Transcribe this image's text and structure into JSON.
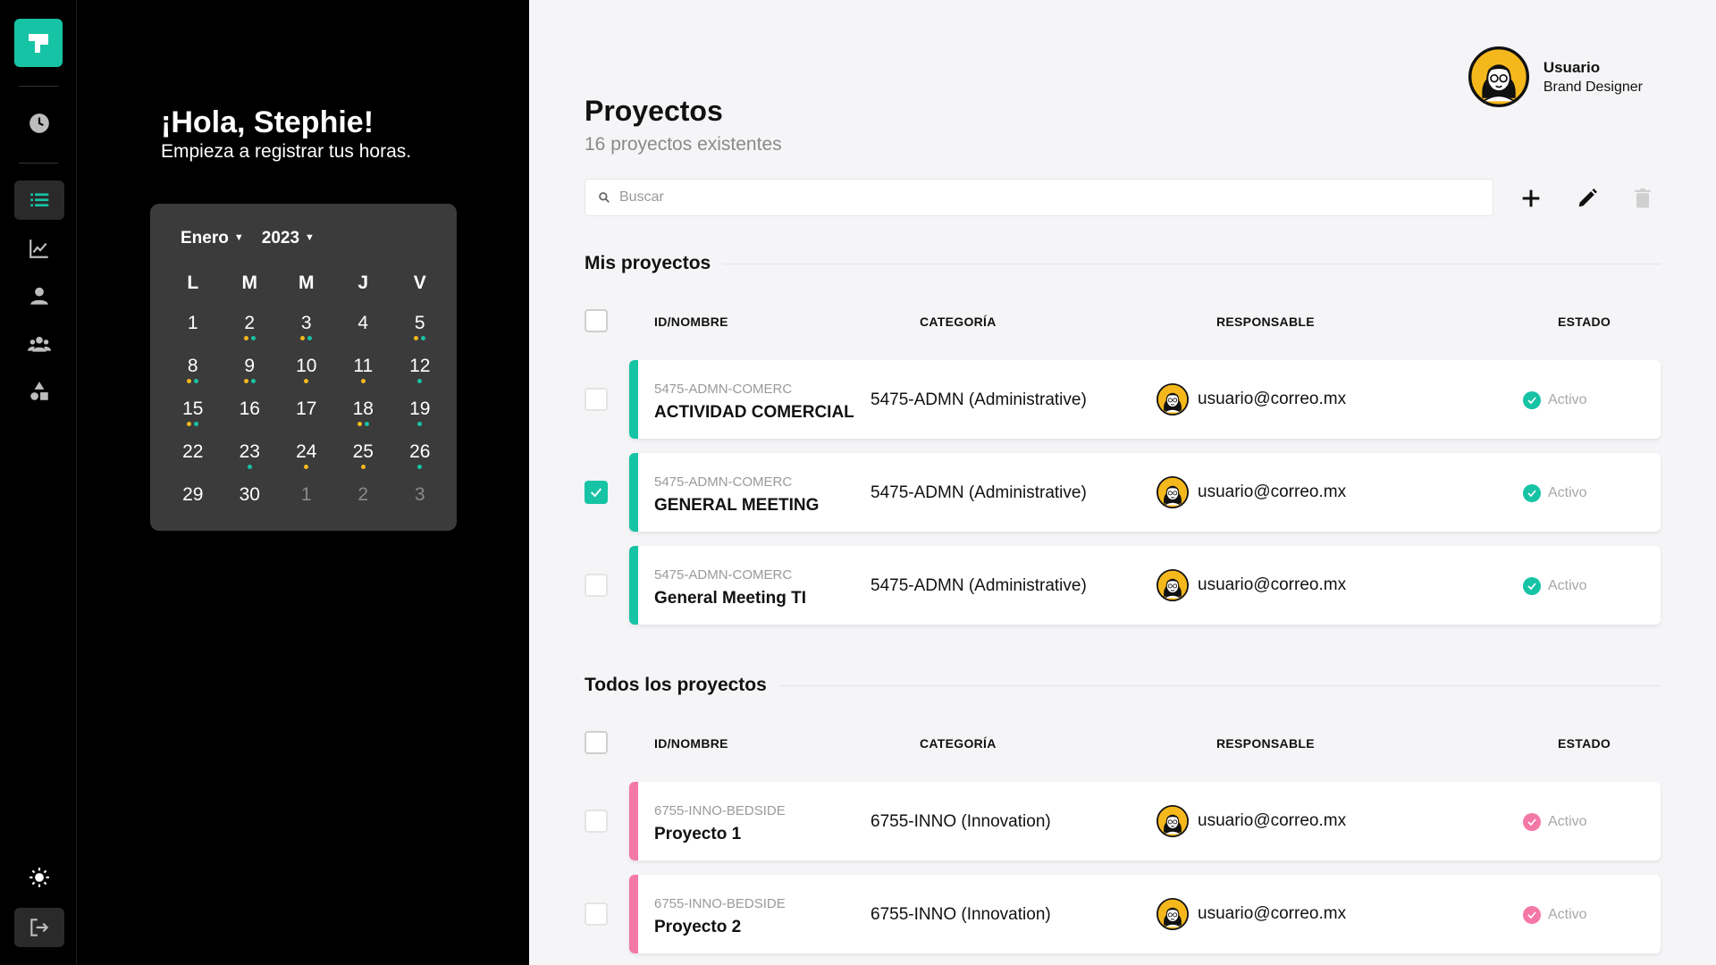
{
  "colors": {
    "teal": "#17c3a5",
    "pink": "#f478a6",
    "dot_yellow": "#f5b81c",
    "dot_teal": "#17c3a5"
  },
  "sidebar": {
    "logo_icon": "app-logo-icon",
    "items": [
      {
        "icon": "clock-icon",
        "name": "nav-clock"
      },
      {
        "icon": "list-icon",
        "name": "nav-projects",
        "active": true
      },
      {
        "icon": "chart-icon",
        "name": "nav-reports"
      },
      {
        "icon": "user-icon",
        "name": "nav-user"
      },
      {
        "icon": "team-icon",
        "name": "nav-team"
      },
      {
        "icon": "shapes-icon",
        "name": "nav-categories"
      }
    ],
    "bottom": [
      {
        "icon": "sun-icon"
      },
      {
        "icon": "logout-icon"
      }
    ]
  },
  "greeting": {
    "title": "¡Hola, Stephie!",
    "subtitle": "Empieza a registrar tus horas."
  },
  "calendar": {
    "month": "Enero",
    "year": "2023",
    "weekdays": [
      "L",
      "M",
      "M",
      "J",
      "V"
    ],
    "days": [
      {
        "d": "1",
        "dots": []
      },
      {
        "d": "2",
        "dots": [
          "y",
          "t"
        ]
      },
      {
        "d": "3",
        "dots": [
          "y",
          "t"
        ]
      },
      {
        "d": "4",
        "dots": []
      },
      {
        "d": "5",
        "dots": [
          "y",
          "t"
        ]
      },
      {
        "d": "8",
        "dots": [
          "y",
          "t"
        ]
      },
      {
        "d": "9",
        "dots": [
          "y",
          "t"
        ]
      },
      {
        "d": "10",
        "dots": [
          "y"
        ]
      },
      {
        "d": "11",
        "dots": [
          "y"
        ]
      },
      {
        "d": "12",
        "dots": [
          "t"
        ]
      },
      {
        "d": "15",
        "dots": [
          "y",
          "t"
        ]
      },
      {
        "d": "16",
        "dots": []
      },
      {
        "d": "17",
        "dots": []
      },
      {
        "d": "18",
        "dots": [
          "y",
          "t"
        ]
      },
      {
        "d": "19",
        "dots": [
          "t"
        ]
      },
      {
        "d": "22",
        "dots": []
      },
      {
        "d": "23",
        "dots": [
          "t"
        ]
      },
      {
        "d": "24",
        "dots": [
          "y"
        ]
      },
      {
        "d": "25",
        "dots": [
          "y"
        ]
      },
      {
        "d": "26",
        "dots": [
          "t"
        ]
      },
      {
        "d": "29",
        "dots": []
      },
      {
        "d": "30",
        "dots": []
      },
      {
        "d": "1",
        "dots": [],
        "muted": true
      },
      {
        "d": "2",
        "dots": [],
        "muted": true
      },
      {
        "d": "3",
        "dots": [],
        "muted": true
      }
    ]
  },
  "user": {
    "name": "Usuario",
    "role": "Brand Designer"
  },
  "header": {
    "title": "Proyectos",
    "subtitle": "16 proyectos existentes"
  },
  "search": {
    "placeholder": "Buscar",
    "value": ""
  },
  "toolbar": {
    "add_icon": "plus-icon",
    "edit_icon": "pencil-icon",
    "delete_icon": "trash-icon"
  },
  "columns": {
    "id": "ID/NOMBRE",
    "category": "CATEGORÍA",
    "owner": "RESPONSABLE",
    "status": "ESTADO"
  },
  "my_projects": {
    "title": "Mis proyectos",
    "rows": [
      {
        "id": "5475-ADMN-COMERC",
        "name": "ACTIVIDAD COMERCIAL",
        "category": "5475-ADMN (Administrative)",
        "owner": "usuario@correo.mx",
        "status": "Activo",
        "checked": false
      },
      {
        "id": "5475-ADMN-COMERC",
        "name": "GENERAL MEETING",
        "category": "5475-ADMN (Administrative)",
        "owner": "usuario@correo.mx",
        "status": "Activo",
        "checked": true
      },
      {
        "id": "5475-ADMN-COMERC",
        "name": "General Meeting TI",
        "category": "5475-ADMN (Administrative)",
        "owner": "usuario@correo.mx",
        "status": "Activo",
        "checked": false
      }
    ]
  },
  "all_projects": {
    "title": "Todos los proyectos",
    "rows": [
      {
        "id": "6755-INNO-BEDSIDE",
        "name": "Proyecto 1",
        "category": "6755-INNO (Innovation)",
        "owner": "usuario@correo.mx",
        "status": "Activo",
        "checked": false
      },
      {
        "id": "6755-INNO-BEDSIDE",
        "name": "Proyecto 2",
        "category": "6755-INNO (Innovation)",
        "owner": "usuario@correo.mx",
        "status": "Activo",
        "checked": false
      }
    ]
  }
}
